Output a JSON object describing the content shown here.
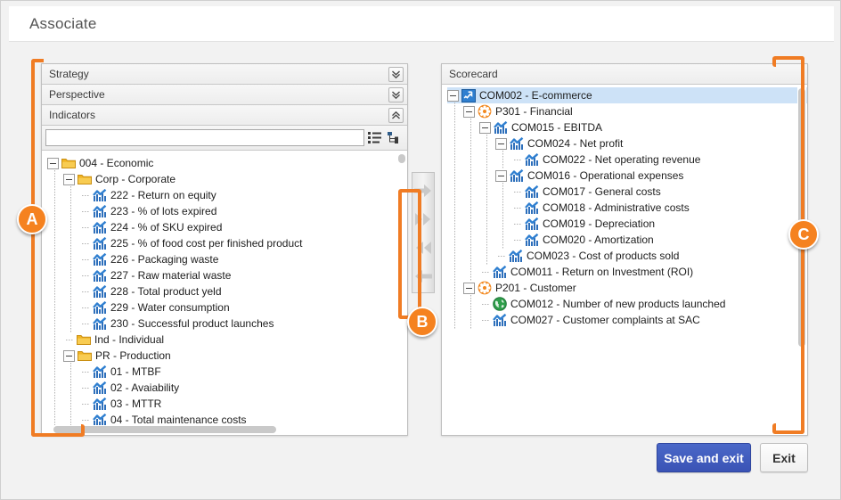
{
  "window": {
    "title": "Associate"
  },
  "left_panel": {
    "accordion": [
      {
        "label": "Strategy",
        "state": "collapsed",
        "icon": "chevron-double-down-icon"
      },
      {
        "label": "Perspective",
        "state": "collapsed",
        "icon": "chevron-double-down-icon"
      },
      {
        "label": "Indicators",
        "state": "expanded",
        "icon": "chevron-double-up-icon"
      }
    ],
    "search": {
      "value": "",
      "placeholder": ""
    },
    "toolbar_icons": [
      "list-view-icon",
      "tree-view-icon"
    ],
    "tree": [
      {
        "depth": 0,
        "toggle": "minus",
        "icon": "folder-icon",
        "label": "004 - Economic"
      },
      {
        "depth": 1,
        "toggle": "minus",
        "icon": "folder-icon",
        "label": "Corp - Corporate"
      },
      {
        "depth": 2,
        "toggle": "none",
        "icon": "indicator-icon",
        "label": "222 - Return on equity"
      },
      {
        "depth": 2,
        "toggle": "none",
        "icon": "indicator-icon",
        "label": "223 - % of lots expired"
      },
      {
        "depth": 2,
        "toggle": "none",
        "icon": "indicator-icon",
        "label": "224 - % of SKU expired"
      },
      {
        "depth": 2,
        "toggle": "none",
        "icon": "indicator-icon",
        "label": "225 - % of food cost per finished product"
      },
      {
        "depth": 2,
        "toggle": "none",
        "icon": "indicator-icon",
        "label": "226 - Packaging waste"
      },
      {
        "depth": 2,
        "toggle": "none",
        "icon": "indicator-icon",
        "label": "227 - Raw material waste"
      },
      {
        "depth": 2,
        "toggle": "none",
        "icon": "indicator-icon",
        "label": "228 - Total product yeld"
      },
      {
        "depth": 2,
        "toggle": "none",
        "icon": "indicator-icon",
        "label": "229 - Water consumption"
      },
      {
        "depth": 2,
        "toggle": "none",
        "icon": "indicator-icon",
        "label": "230 - Successful product launches"
      },
      {
        "depth": 1,
        "toggle": "none",
        "icon": "folder-icon",
        "label": "Ind - Individual"
      },
      {
        "depth": 1,
        "toggle": "minus",
        "icon": "folder-icon",
        "label": "PR - Production"
      },
      {
        "depth": 2,
        "toggle": "none",
        "icon": "indicator-icon",
        "label": "01 - MTBF"
      },
      {
        "depth": 2,
        "toggle": "none",
        "icon": "indicator-icon",
        "label": "02 - Avaiability"
      },
      {
        "depth": 2,
        "toggle": "none",
        "icon": "indicator-icon",
        "label": "03 - MTTR"
      },
      {
        "depth": 2,
        "toggle": "none",
        "icon": "indicator-icon",
        "label": "04 - Total maintenance costs"
      }
    ]
  },
  "transfer": {
    "buttons": [
      {
        "name": "move-right-button",
        "icon": "arrow-right-icon"
      },
      {
        "name": "move-all-right-button",
        "icon": "arrow-double-right-icon"
      },
      {
        "name": "move-all-left-button",
        "icon": "arrow-double-left-icon"
      },
      {
        "name": "move-left-button",
        "icon": "arrow-left-icon"
      }
    ]
  },
  "right_panel": {
    "header": "Scorecard",
    "tree": [
      {
        "depth": 0,
        "toggle": "minus",
        "icon": "scorecard-icon",
        "label": "COM002 - E-commerce",
        "selected": true
      },
      {
        "depth": 1,
        "toggle": "minus",
        "icon": "perspective-icon",
        "label": "P301 - Financial"
      },
      {
        "depth": 2,
        "toggle": "minus",
        "icon": "indicator-icon",
        "label": "COM015 - EBITDA"
      },
      {
        "depth": 3,
        "toggle": "minus",
        "icon": "indicator-icon",
        "label": "COM024 - Net profit"
      },
      {
        "depth": 4,
        "toggle": "none",
        "icon": "indicator-icon",
        "label": "COM022 - Net operating revenue"
      },
      {
        "depth": 3,
        "toggle": "minus",
        "icon": "indicator-icon",
        "label": "COM016 - Operational expenses"
      },
      {
        "depth": 4,
        "toggle": "none",
        "icon": "indicator-icon",
        "label": "COM017 - General costs"
      },
      {
        "depth": 4,
        "toggle": "none",
        "icon": "indicator-icon",
        "label": "COM018 - Administrative costs"
      },
      {
        "depth": 4,
        "toggle": "none",
        "icon": "indicator-icon",
        "label": "COM019 - Depreciation"
      },
      {
        "depth": 4,
        "toggle": "none",
        "icon": "indicator-icon",
        "label": "COM020 - Amortization"
      },
      {
        "depth": 3,
        "toggle": "none",
        "icon": "indicator-icon",
        "label": "COM023 - Cost of products sold"
      },
      {
        "depth": 2,
        "toggle": "none",
        "icon": "indicator-icon",
        "label": "COM011 - Return on Investment (ROI)"
      },
      {
        "depth": 1,
        "toggle": "minus",
        "icon": "perspective-icon",
        "label": "P201 - Customer"
      },
      {
        "depth": 2,
        "toggle": "none",
        "icon": "globe-icon",
        "label": "COM012 - Number of new products launched"
      },
      {
        "depth": 2,
        "toggle": "none",
        "icon": "indicator-icon",
        "label": "COM027 - Customer complaints at SAC"
      }
    ]
  },
  "footer": {
    "save_label": "Save and exit",
    "exit_label": "Exit"
  },
  "annotations": {
    "a": "A",
    "b": "B",
    "c": "C",
    "color": "#f58220"
  }
}
